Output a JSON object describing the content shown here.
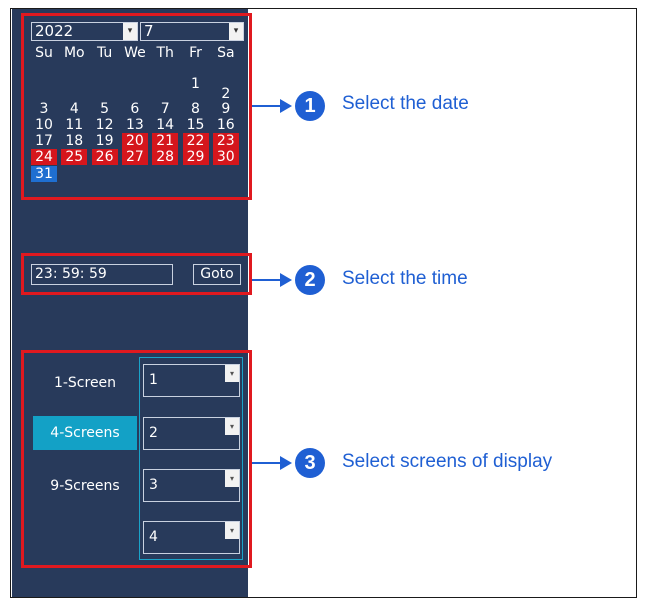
{
  "calendar": {
    "year": "2022",
    "month": "7",
    "weekdays": [
      "Su",
      "Mo",
      "Tu",
      "We",
      "Th",
      "Fr",
      "Sa"
    ],
    "weeks": [
      [
        "",
        "",
        "",
        "",
        "",
        "1",
        "2"
      ],
      [
        "3",
        "4",
        "5",
        "6",
        "7",
        "8",
        "9"
      ],
      [
        "10",
        "11",
        "12",
        "13",
        "14",
        "15",
        "16"
      ],
      [
        "17",
        "18",
        "19",
        "20",
        "21",
        "22",
        "23"
      ],
      [
        "24",
        "25",
        "26",
        "27",
        "28",
        "29",
        "30"
      ],
      [
        "31",
        "",
        "",
        "",
        "",
        "",
        ""
      ]
    ],
    "highlighted_red": [
      "20",
      "21",
      "22",
      "23",
      "24",
      "25",
      "26",
      "27",
      "28",
      "29",
      "30"
    ],
    "selected_day": "31"
  },
  "time": {
    "value": "23: 59: 59",
    "goto_label": "Goto"
  },
  "screens": {
    "options": [
      "1-Screen",
      "4-Screens",
      "9-Screens"
    ],
    "active": "4-Screens",
    "channels": [
      "1",
      "2",
      "3",
      "4"
    ]
  },
  "annotations": [
    {
      "number": "1",
      "text": "Select the date"
    },
    {
      "number": "2",
      "text": "Select the time"
    },
    {
      "number": "3",
      "text": "Select screens of display"
    }
  ],
  "colors": {
    "panel": "#283a5b",
    "highlight_red": "#d5161c",
    "selected_blue": "#1f6fd1",
    "active_teal": "#13a1c6",
    "annotation_blue": "#1f5fd3",
    "callout_red": "#e0191f"
  },
  "icons": {
    "dropdown": "chevron-down-icon"
  }
}
